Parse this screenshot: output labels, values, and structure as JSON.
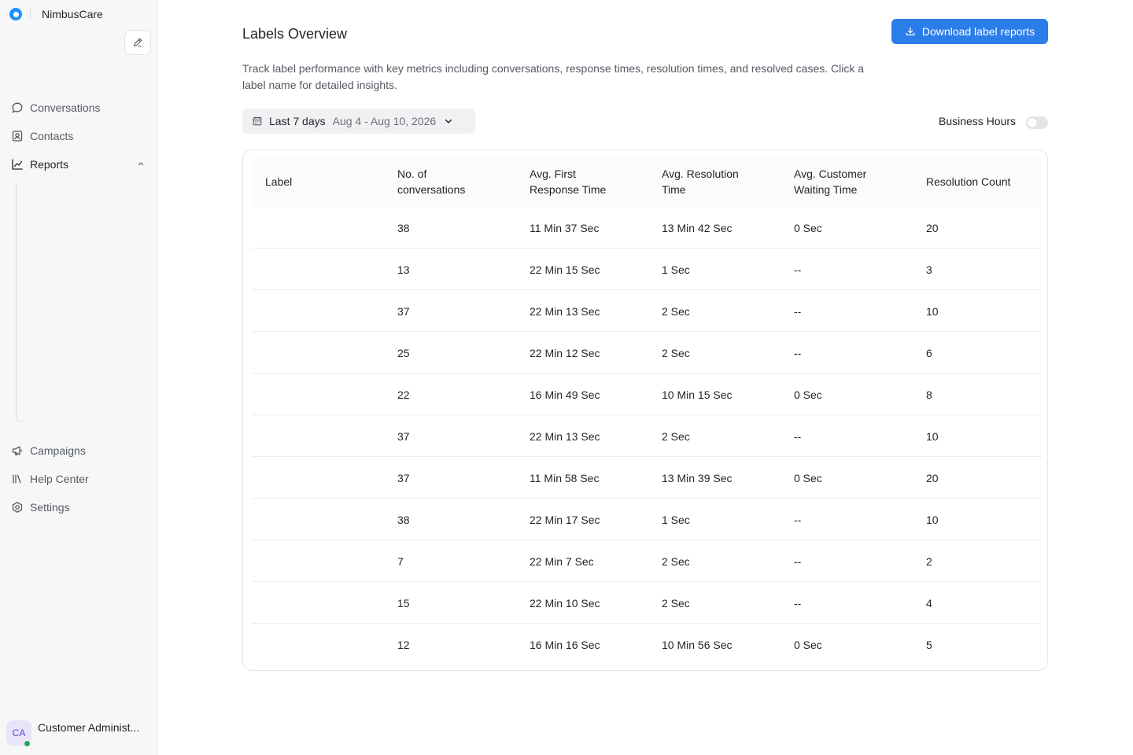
{
  "app": {
    "name": "NimbusCare"
  },
  "sidebar": {
    "nav": [
      {
        "label": "Conversations",
        "icon": "chat-bubble-icon"
      },
      {
        "label": "Contacts",
        "icon": "contact-card-icon"
      },
      {
        "label": "Reports",
        "icon": "line-chart-icon",
        "expanded": true
      },
      {
        "label": "Campaigns",
        "icon": "megaphone-icon"
      },
      {
        "label": "Help Center",
        "icon": "library-icon"
      },
      {
        "label": "Settings",
        "icon": "gear-icon"
      }
    ],
    "user": {
      "initials": "CA",
      "name": "Customer Administ...",
      "status": "online"
    }
  },
  "page": {
    "title": "Labels Overview",
    "download_label": "Download label reports",
    "description": "Track label performance with key metrics including conversations, response times, resolution times, and resolved cases. Click a label name for detailed insights.",
    "range": {
      "label": "Last 7 days",
      "dates": "Aug 4 - Aug 10, 2026"
    },
    "business_hours": {
      "label": "Business Hours",
      "enabled": false
    }
  },
  "table": {
    "columns": [
      {
        "label": "Label"
      },
      {
        "label": "No. of",
        "label2": "conversations"
      },
      {
        "label": "Avg. First",
        "label2": "Response Time"
      },
      {
        "label": "Avg. Resolution",
        "label2": "Time"
      },
      {
        "label": "Avg. Customer",
        "label2": "Waiting Time"
      },
      {
        "label": "Resolution Count"
      }
    ],
    "rows": [
      [
        "",
        "38",
        "11 Min 37 Sec",
        "13 Min 42 Sec",
        "0 Sec",
        "20"
      ],
      [
        "",
        "13",
        "22 Min 15 Sec",
        "1 Sec",
        "--",
        "3"
      ],
      [
        "",
        "37",
        "22 Min 13 Sec",
        "2 Sec",
        "--",
        "10"
      ],
      [
        "",
        "25",
        "22 Min 12 Sec",
        "2 Sec",
        "--",
        "6"
      ],
      [
        "",
        "22",
        "16 Min 49 Sec",
        "10 Min 15 Sec",
        "0 Sec",
        "8"
      ],
      [
        "",
        "37",
        "22 Min 13 Sec",
        "2 Sec",
        "--",
        "10"
      ],
      [
        "",
        "37",
        "11 Min 58 Sec",
        "13 Min 39 Sec",
        "0 Sec",
        "20"
      ],
      [
        "",
        "38",
        "22 Min 17 Sec",
        "1 Sec",
        "--",
        "10"
      ],
      [
        "",
        "7",
        "22 Min 7 Sec",
        "2 Sec",
        "--",
        "2"
      ],
      [
        "",
        "15",
        "22 Min 10 Sec",
        "2 Sec",
        "--",
        "4"
      ],
      [
        "",
        "12",
        "16 Min 16 Sec",
        "10 Min 56 Sec",
        "0 Sec",
        "5"
      ]
    ]
  },
  "colors": {
    "accent": "#2b7de9",
    "brand": "#1f8fff",
    "online": "#23a559"
  }
}
